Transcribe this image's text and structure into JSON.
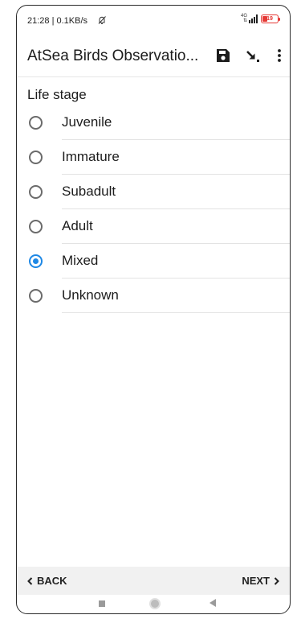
{
  "status_bar": {
    "time": "21:28 | 0.1KB/s",
    "network": "4G",
    "battery": "19"
  },
  "app_bar": {
    "title": "AtSea Birds Observatio...",
    "icons": [
      "save-icon",
      "go-to-icon",
      "more-vert-icon"
    ]
  },
  "question": {
    "label": "Life stage",
    "options": [
      {
        "label": "Juvenile",
        "selected": false
      },
      {
        "label": "Immature",
        "selected": false
      },
      {
        "label": "Subadult",
        "selected": false
      },
      {
        "label": "Adult",
        "selected": false
      },
      {
        "label": "Mixed",
        "selected": true
      },
      {
        "label": "Unknown",
        "selected": false
      }
    ]
  },
  "nav": {
    "back_label": "BACK",
    "next_label": "NEXT"
  },
  "colors": {
    "accent": "#1e88e5",
    "battery_low": "#e53935"
  }
}
